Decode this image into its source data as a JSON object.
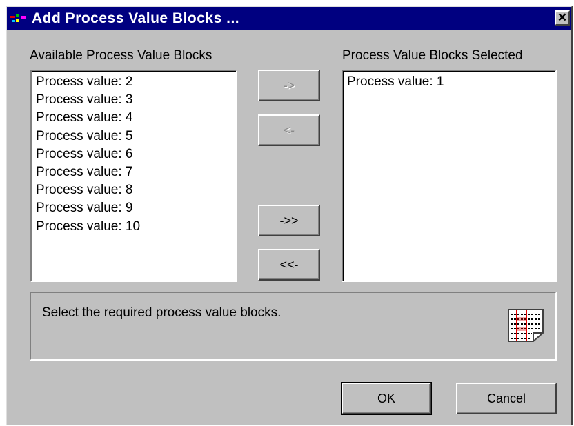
{
  "window": {
    "title": "Add Process Value Blocks ...",
    "close_glyph": "✕"
  },
  "available": {
    "label": "Available Process Value Blocks",
    "items": [
      "Process value:  2",
      "Process value:  3",
      "Process value:  4",
      "Process value:  5",
      "Process value:  6",
      "Process value:  7",
      "Process value:  8",
      "Process value:  9",
      "Process value: 10"
    ]
  },
  "selected": {
    "label": "Process Value Blocks Selected",
    "items": [
      "Process value:  1"
    ]
  },
  "transfer_buttons": {
    "add": "->",
    "remove": "<-",
    "add_all": "->>",
    "remove_all": "<<-"
  },
  "info": {
    "text": "Select the required process value blocks.",
    "icon": "process-list-icon"
  },
  "footer": {
    "ok": "OK",
    "cancel": "Cancel"
  },
  "colors": {
    "titlebar": "#000080",
    "face": "#c0c0c0",
    "icon_red": "#e00000"
  }
}
